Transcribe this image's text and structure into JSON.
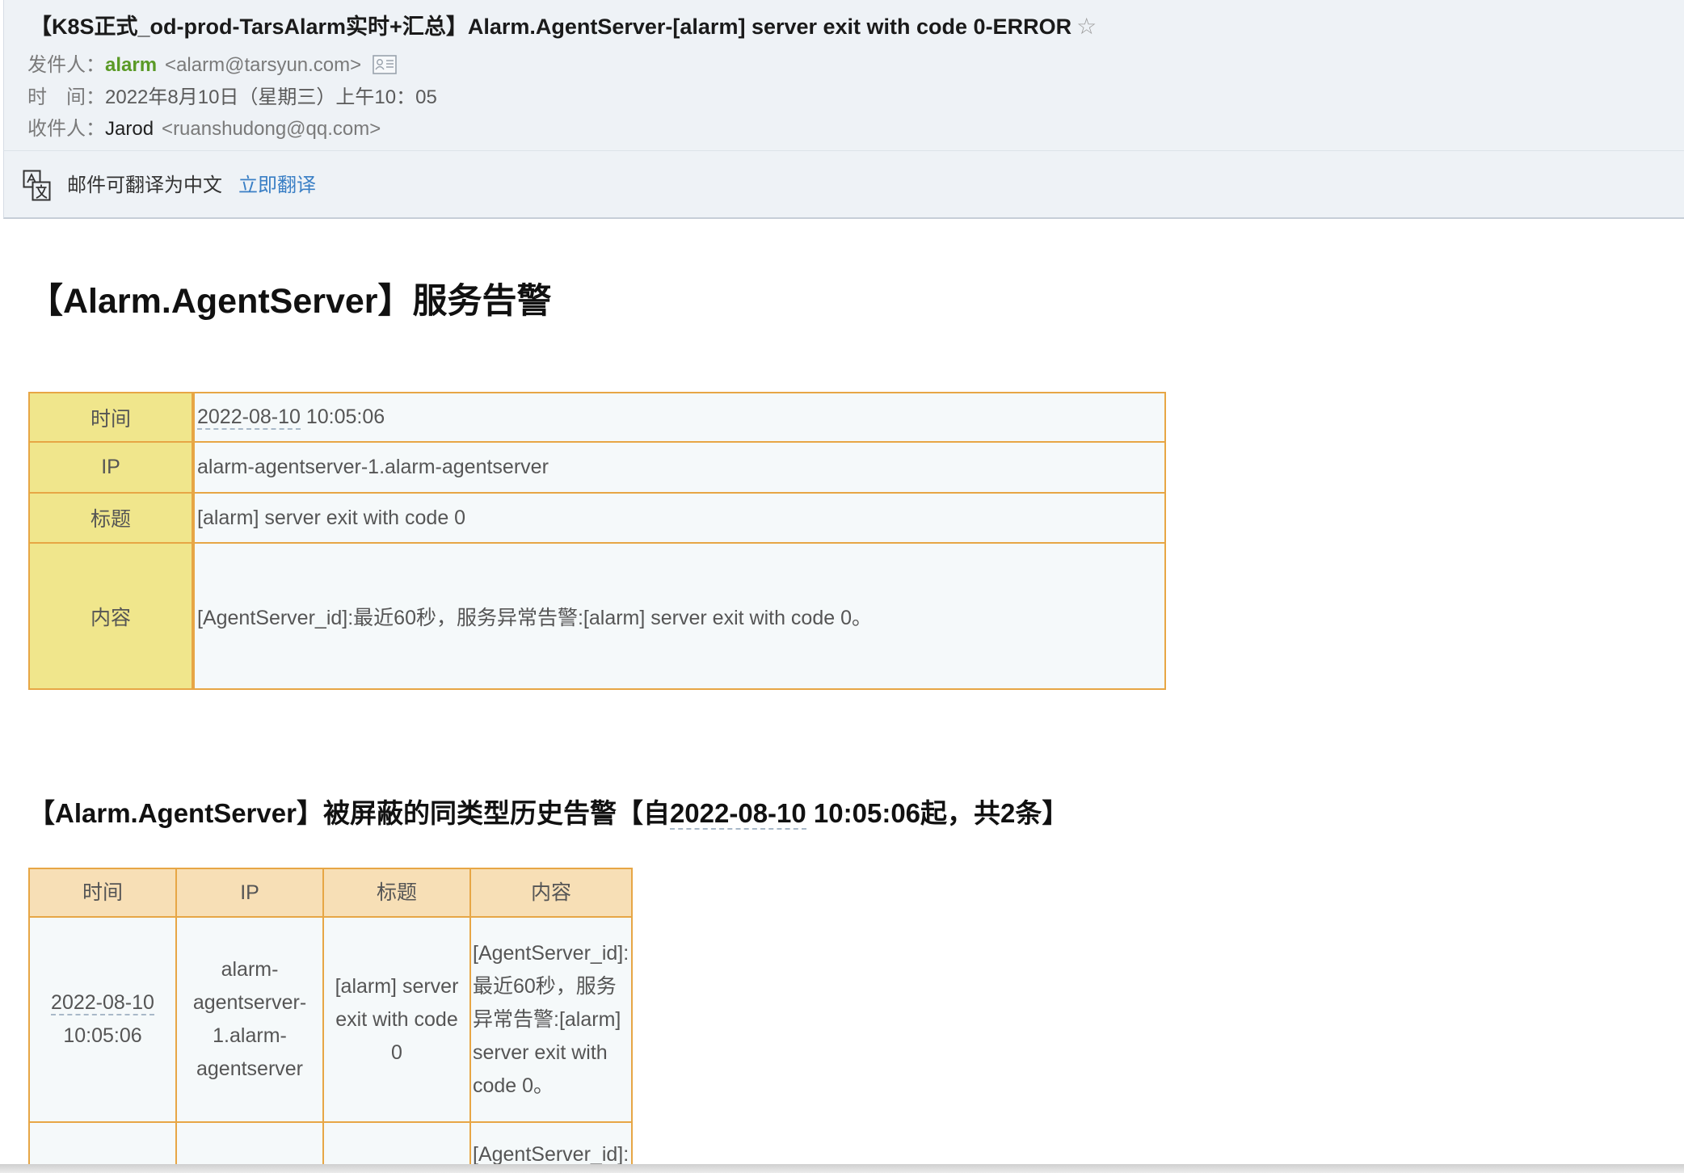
{
  "mail": {
    "subject": "【K8S正式_od-prod-TarsAlarm实时+汇总】Alarm.AgentServer-[alarm] server exit with code 0-ERROR",
    "from": {
      "label": "发件人：",
      "name": "alarm",
      "address": "<alarm@tarsyun.com>"
    },
    "time": {
      "label": "时　间：",
      "value": "2022年8月10日（星期三）上午10：05"
    },
    "to": {
      "label": "收件人：",
      "name": "Jarod",
      "address": "<ruanshudong@qq.com>"
    },
    "icons": {
      "star": "star-outline-icon",
      "contact_card": "contact-card-icon"
    }
  },
  "translate_bar": {
    "icon": "translate-icon",
    "message": "邮件可翻译为中文",
    "action": "立即翻译"
  },
  "body": {
    "alert_heading": "【Alarm.AgentServer】服务告警",
    "alert_table": {
      "rows": [
        {
          "label": "时间",
          "date": "2022-08-10",
          "time": "10:05:06"
        },
        {
          "label": "IP",
          "value": "alarm-agentserver-1.alarm-agentserver"
        },
        {
          "label": "标题",
          "value": "[alarm] server exit with code 0"
        },
        {
          "label": "内容",
          "value": "[AgentServer_id]:最近60秒，服务异常告警:[alarm] server exit with code 0。"
        }
      ]
    },
    "history_heading": {
      "prefix": "【Alarm.AgentServer】被屏蔽的同类型历史告警【自",
      "date": "2022-08-10",
      "suffix": " 10:05:06起，共2条】"
    },
    "history_table": {
      "headers": [
        "时间",
        "IP",
        "标题",
        "内容"
      ],
      "rows": [
        {
          "date": "2022-08-10",
          "time": "10:05:06",
          "ip": "alarm-agentserver-1.alarm-agentserver",
          "title": "[alarm] server exit with code 0",
          "content": "[AgentServer_id]:最近60秒，服务异常告警:[alarm] server exit with code 0。"
        },
        {
          "content": "[AgentServer_id]:"
        }
      ]
    }
  },
  "colors": {
    "header_bg": "#eef2f6",
    "header_border": "#c6ced7",
    "sender_green": "#5a9a26",
    "link_blue": "#3a7fc5",
    "table_border": "#e7a645",
    "label_bg": "#f0e68c",
    "history_header_bg": "#f7dfb6",
    "cell_bg": "#f5f9fa",
    "text_gray": "#555555",
    "date_underline": "#a8b8c8"
  }
}
